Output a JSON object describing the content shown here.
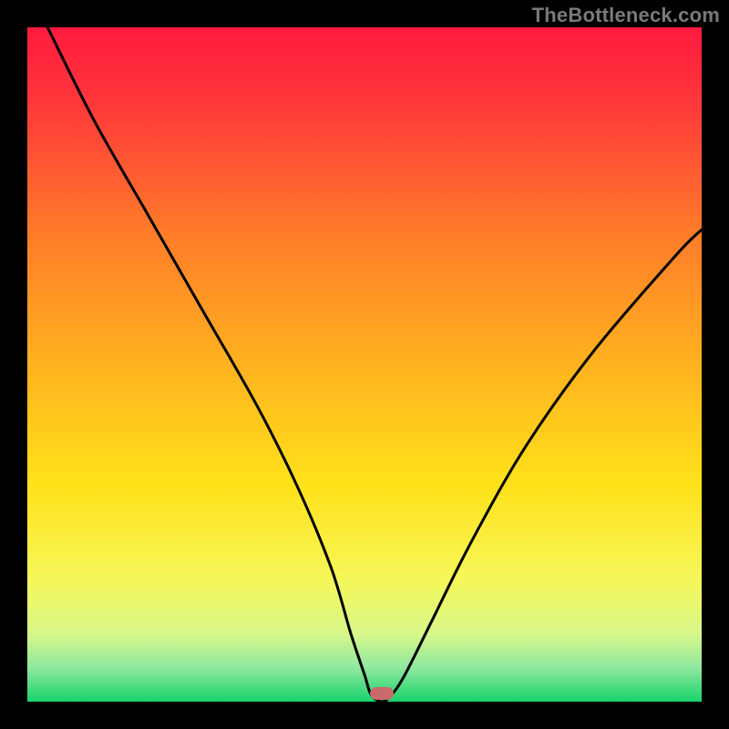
{
  "watermark": "TheBottleneck.com",
  "gradient": {
    "stops": [
      {
        "offset": 0.0,
        "color": "#ff1a3f"
      },
      {
        "offset": 0.12,
        "color": "#ff3a3a"
      },
      {
        "offset": 0.3,
        "color": "#ff7a2a"
      },
      {
        "offset": 0.5,
        "color": "#ffb21f"
      },
      {
        "offset": 0.68,
        "color": "#ffe21a"
      },
      {
        "offset": 0.82,
        "color": "#f5f75a"
      },
      {
        "offset": 0.9,
        "color": "#d8f78a"
      },
      {
        "offset": 0.95,
        "color": "#8ee8a0"
      },
      {
        "offset": 1.0,
        "color": "#18d36a"
      }
    ]
  },
  "marker": {
    "x_frac": 0.526,
    "y_frac": 0.988,
    "fill": "#c96a6a"
  },
  "curve": {
    "color": "#000000",
    "width": 3
  },
  "chart_data": {
    "type": "line",
    "title": "",
    "xlabel": "",
    "ylabel": "",
    "xlim": [
      0,
      100
    ],
    "ylim": [
      0,
      100
    ],
    "grid": false,
    "legend": false,
    "note": "Bottleneck-style curve; y≈0 at the marker x, rising toward both edges. Values estimated from pixel positions (no axis ticks present).",
    "series": [
      {
        "name": "bottleneck",
        "x": [
          3,
          10,
          18,
          26,
          34,
          40,
          45,
          48,
          50,
          51,
          52.6,
          54,
          56,
          60,
          66,
          74,
          84,
          96,
          100
        ],
        "y": [
          100,
          86,
          72,
          58,
          44,
          32,
          20,
          10,
          4,
          1,
          0,
          1,
          4,
          12,
          24,
          38,
          52,
          66,
          70
        ]
      }
    ],
    "optimal_point": {
      "x": 52.6,
      "y": 0
    }
  }
}
